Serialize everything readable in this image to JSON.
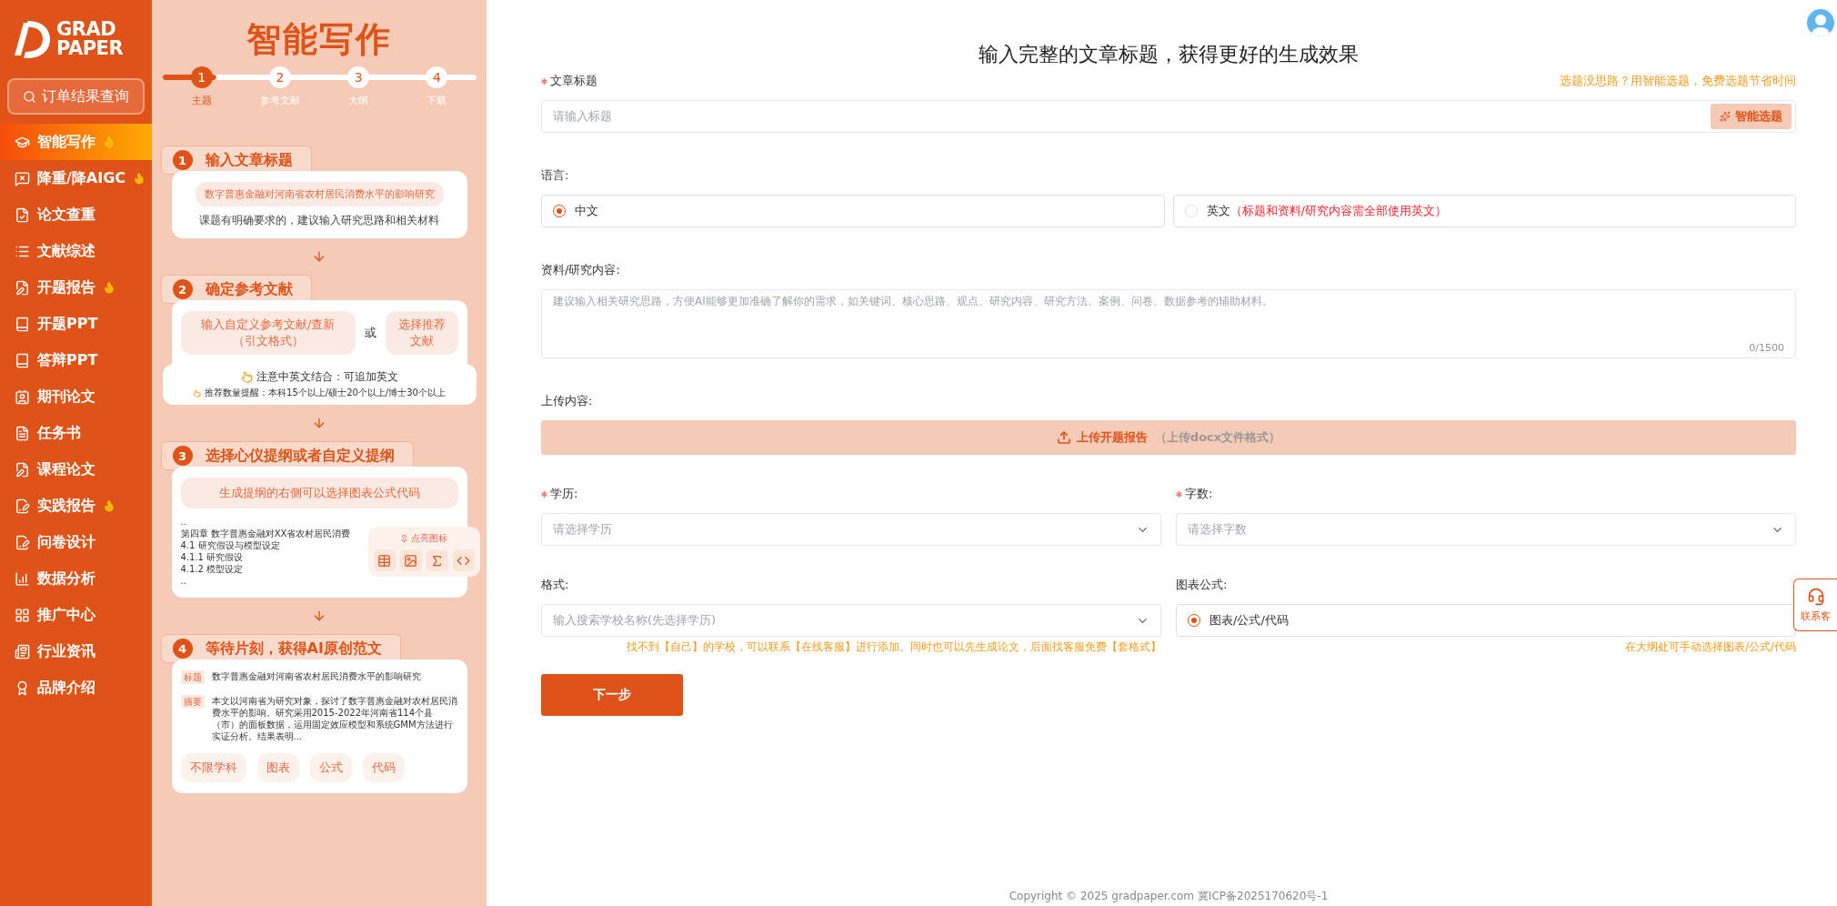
{
  "sidebar": {
    "logo": {
      "line1": "GRAD",
      "line2": "PAPER"
    },
    "search_button": "订单结果查询",
    "items": [
      {
        "label": "智能写作",
        "kind": "cap",
        "hot": true,
        "selected": true
      },
      {
        "label": "降重/降AIGC",
        "kind": "chat",
        "hot": true,
        "selected": false
      },
      {
        "label": "论文查重",
        "kind": "check",
        "hot": false,
        "selected": false
      },
      {
        "label": "文献综述",
        "kind": "list",
        "hot": false,
        "selected": false
      },
      {
        "label": "开题报告",
        "kind": "report",
        "hot": true,
        "selected": false
      },
      {
        "label": "开题PPT",
        "kind": "book",
        "hot": false,
        "selected": false
      },
      {
        "label": "答辩PPT",
        "kind": "book",
        "hot": false,
        "selected": false
      },
      {
        "label": "期刊论文",
        "kind": "journal",
        "hot": false,
        "selected": false
      },
      {
        "label": "任务书",
        "kind": "lines",
        "hot": false,
        "selected": false
      },
      {
        "label": "课程论文",
        "kind": "report",
        "hot": false,
        "selected": false
      },
      {
        "label": "实践报告",
        "kind": "pen",
        "hot": true,
        "selected": false
      },
      {
        "label": "问卷设计",
        "kind": "pen",
        "hot": false,
        "selected": false
      },
      {
        "label": "数据分析",
        "kind": "chart",
        "hot": false,
        "selected": false
      },
      {
        "label": "推广中心",
        "kind": "grid",
        "hot": false,
        "selected": false
      },
      {
        "label": "行业资讯",
        "kind": "news",
        "hot": false,
        "selected": false
      },
      {
        "label": "品牌介绍",
        "kind": "brand",
        "hot": false,
        "selected": false
      }
    ]
  },
  "guide": {
    "title": "智能写作",
    "steps": [
      {
        "number": "1",
        "label": "主题",
        "selected": true
      },
      {
        "number": "2",
        "label": "参考文献",
        "selected": false
      },
      {
        "number": "3",
        "label": "大纲",
        "selected": false
      },
      {
        "number": "4",
        "label": "下载",
        "selected": false
      }
    ],
    "cards": [
      {
        "kind": "title",
        "number": "1",
        "heading": "输入文章标题",
        "example": "数字普惠金融对河南省农村居民消费水平的影响研究",
        "tip": "课题有明确要求的，建议输入研究思路和相关材料"
      },
      {
        "kind": "references",
        "number": "2",
        "heading": "确定参考文献",
        "options": [
          "输入自定义参考文献/查新（引文格式）",
          "选择推荐文献"
        ],
        "separator": "或",
        "note": "注意中英文结合：可追加英文",
        "subnote": "推荐数量提醒：本科15个以上/硕士20个以上/博士30个以上"
      },
      {
        "kind": "outline",
        "number": "3",
        "heading": "选择心仪提纲或者自定义提纲",
        "example": "生成提纲的右侧可以选择图表公式代码",
        "outline": [
          "..",
          "第四章 数字普惠金融对XX省农村居民消费",
          "4.1 研究假设与模型设定",
          "4.1.1 研究假设",
          "4.1.2 模型设定",
          ".."
        ],
        "popup": "点亮图标"
      },
      {
        "kind": "result",
        "number": "4",
        "heading": "等待片刻，获得AI原创范文",
        "fields": [
          {
            "tag": "标题",
            "text": "数字普惠金融对河南省农村居民消费水平的影响研究"
          },
          {
            "tag": "摘要",
            "text": "本文以河南省为研究对象，探讨了数字普惠金融对农村居民消费水平的影响。研究采用2015-2022年河南省114个县（市）的面板数据，运用固定效应模型和系统GMM方法进行实证分析。结果表明..."
          }
        ],
        "chips": [
          "不限学科",
          "图表",
          "公式",
          "代码"
        ]
      }
    ]
  },
  "form": {
    "heading": "输入完整的文章标题，获得更好的生成效果",
    "title_field": {
      "label": "文章标题",
      "required": true,
      "hint": "选题没思路？用智能选题，免费选题节省时间",
      "placeholder": "请输入标题",
      "button": "智能选题"
    },
    "language": {
      "label": "语言:",
      "options": [
        {
          "label": "中文",
          "selected": true
        },
        {
          "label": "英文",
          "note": "（标题和资料/研究内容需全部使用英文）",
          "selected": false
        }
      ]
    },
    "material": {
      "label": "资料/研究内容:",
      "placeholder": "建议输入相关研究思路，方便AI能够更加准确了解你的需求，如关键词、核心思路、观点、研究内容、研究方法、案例、问卷、数据参考的辅助材料。",
      "counter": "0/1500"
    },
    "upload": {
      "label": "上传内容:",
      "button": "上传开题报告",
      "note": "（上传docx文件格式）"
    },
    "degree": {
      "label": "学历:",
      "required": true,
      "placeholder": "请选择学历"
    },
    "word_count": {
      "label": "字数:",
      "required": true,
      "placeholder": "请选择字数"
    },
    "format": {
      "label": "格式:",
      "required": false,
      "placeholder": "输入搜索学校名称(先选择学历)",
      "hint": "找不到【自己】的学校，可以联系【在线客服】进行添加。同时也可以先生成论文，后面找客服免费【套格式】"
    },
    "charts": {
      "label": "图表公式:",
      "options": [
        {
          "label": "图表/公式/代码",
          "selected": true
        }
      ],
      "hint": "在大纲处可手动选择图表/公式/代码"
    },
    "next_button": "下一步"
  },
  "contact": "联系客",
  "footer": "Copyright © 2025 gradpaper.com 冀ICP备2025170620号-1"
}
